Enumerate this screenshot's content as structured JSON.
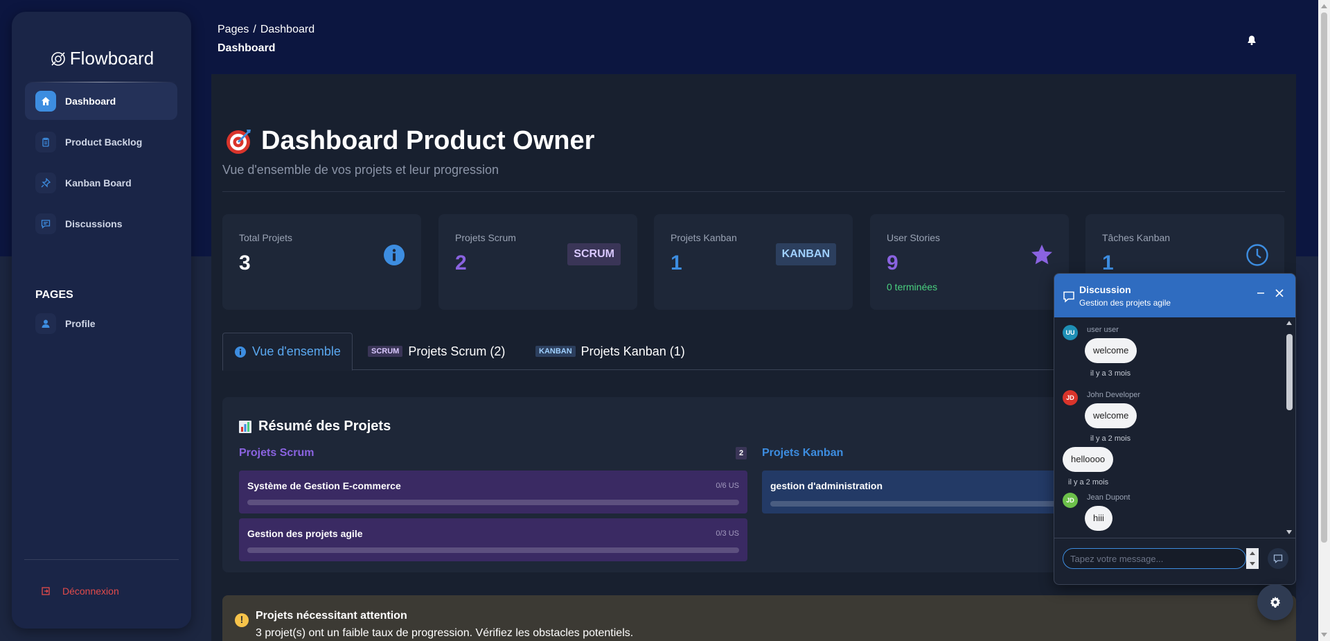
{
  "app": {
    "brand": "Flowboard"
  },
  "sidebar": {
    "items": [
      {
        "label": "Dashboard",
        "icon": "home-icon"
      },
      {
        "label": "Product Backlog",
        "icon": "clipboard-icon"
      },
      {
        "label": "Kanban Board",
        "icon": "pin-icon"
      },
      {
        "label": "Discussions",
        "icon": "chat-icon"
      }
    ],
    "section": "PAGES",
    "pages": [
      {
        "label": "Profile",
        "icon": "user-icon"
      }
    ],
    "logout": "Déconnexion"
  },
  "header": {
    "breadcrumb": [
      "Pages",
      "Dashboard"
    ],
    "breadcrumb_sep": "/",
    "page": "Dashboard"
  },
  "dashboard": {
    "title": "Dashboard Product Owner",
    "subtitle": "Vue d'ensemble de vos projets et leur progression",
    "stats": [
      {
        "label": "Total Projets",
        "value": "3",
        "icon": "info-icon"
      },
      {
        "label": "Projets Scrum",
        "value": "2",
        "badge": "SCRUM"
      },
      {
        "label": "Projets Kanban",
        "value": "1",
        "badge": "KANBAN"
      },
      {
        "label": "User Stories",
        "value": "9",
        "note": "0 terminées",
        "icon": "star-icon"
      },
      {
        "label": "Tâches Kanban",
        "value": "1",
        "icon": "clock-icon"
      }
    ],
    "tabs": [
      {
        "label": "Vue d'ensemble",
        "icon": "info-icon"
      },
      {
        "badge": "SCRUM",
        "label": "Projets Scrum (2)"
      },
      {
        "badge": "KANBAN",
        "label": "Projets Kanban (1)"
      }
    ],
    "summary": {
      "title": "Résumé des Projets",
      "scrum_head": "Projets Scrum",
      "scrum_count": "2",
      "kanban_head": "Projets Kanban",
      "scrum_projects": [
        {
          "name": "Système de Gestion E-commerce",
          "meta": "0/6 US",
          "progress": 0
        },
        {
          "name": "Gestion des projets agile",
          "meta": "0/3 US",
          "progress": 0
        }
      ],
      "kanban_projects": [
        {
          "name": "gestion d'administration",
          "progress": 0
        }
      ]
    },
    "alert": {
      "title": "Projets nécessitant attention",
      "text": "3 projet(s) ont un faible taux de progression. Vérifiez les obstacles potentiels."
    }
  },
  "chat": {
    "title": "Discussion",
    "subtitle": "Gestion des projets agile",
    "messages": [
      {
        "initials": "UU",
        "author": "user user",
        "text": "welcome",
        "time": "il y a 3 mois",
        "color": "#1e8fb5"
      },
      {
        "initials": "JD",
        "author": "John Developer",
        "text": "welcome",
        "time": "il y a 2 mois",
        "color": "#d9342b"
      },
      {
        "text": "helloooo",
        "time": "il y a 2 mois"
      },
      {
        "initials": "JD",
        "author": "Jean Dupont",
        "text": "hiii",
        "color": "#6cc04a"
      }
    ],
    "input_placeholder": "Tapez votre message..."
  },
  "colors": {
    "accent": "#3d8de0",
    "scrum": "#8a63e0",
    "kanban": "#3d8de0",
    "success": "#4ad07f",
    "danger": "#e34b4b",
    "warning": "#f6c34a"
  }
}
